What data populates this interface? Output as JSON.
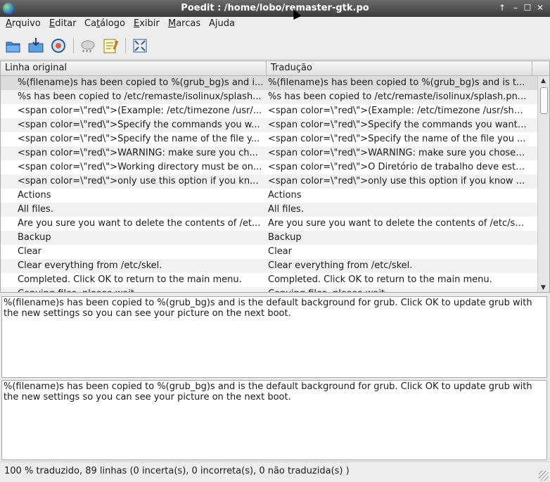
{
  "window": {
    "title": "Poedit : /home/lobo/remaster-gtk.po"
  },
  "menubar": {
    "items": [
      {
        "label": "Arquivo",
        "key": "A"
      },
      {
        "label": "Editar",
        "key": "E"
      },
      {
        "label": "Catálogo",
        "key": "C"
      },
      {
        "label": "Exibir",
        "key": "E"
      },
      {
        "label": "Marcas",
        "key": "M"
      },
      {
        "label": "Ajuda",
        "key": ""
      }
    ]
  },
  "toolbar": {
    "icons": [
      "open-icon",
      "save-icon",
      "update-catalog-icon",
      "fuzzy-icon",
      "comment-icon",
      "fullscreen-icon"
    ]
  },
  "table": {
    "headers": {
      "original": "Linha original",
      "translation": "Tradução"
    },
    "rows": [
      {
        "original": "%(filename)s has been copied to %(grub_bg)s and i...",
        "translation": "%(filename)s has been copied to %(grub_bg)s and is t..."
      },
      {
        "original": "%s has been copied to /etc/remaste/isolinux/splash...",
        "translation": "%s has been copied to /etc/remaste/isolinux/splash.pn..."
      },
      {
        "original": "<span color=\\\"red\\\">(Example: /etc/timezone /usr/...",
        "translation": "<span color=\\\"red\\\">(Example: /etc/timezone /usr/sha..."
      },
      {
        "original": "<span color=\\\"red\\\">Specify the commands you w...",
        "translation": "<span color=\\\"red\\\">Specify the commands you want ..."
      },
      {
        "original": "<span color=\\\"red\\\">Specify the name of the file y...",
        "translation": "<span color=\\\"red\\\">Specify the name of the file you ..."
      },
      {
        "original": "<span color=\\\"red\\\">WARNING: make sure you ch...",
        "translation": "<span color=\\\"red\\\">WARNING: make sure you chose ..."
      },
      {
        "original": "<span color=\\\"red\\\">Working directory must be on...",
        "translation": "<span color=\\\"red\\\">O Diretório de trabalho deve esta..."
      },
      {
        "original": "<span color=\\\"red\\\">only use this option if you kn...",
        "translation": "<span color=\\\"red\\\">only use this option if you know ..."
      },
      {
        "original": "Actions",
        "translation": "Actions"
      },
      {
        "original": "All files.",
        "translation": "All files."
      },
      {
        "original": "Are you sure you want to delete the contents of /et...",
        "translation": "Are you sure you want to delete the contents of /etc/sk..."
      },
      {
        "original": "Backup",
        "translation": "Backup"
      },
      {
        "original": "Clear",
        "translation": "Clear"
      },
      {
        "original": "Clear everything from /etc/skel.",
        "translation": "Clear everything from /etc/skel."
      },
      {
        "original": "Completed. Click OK to return to the main menu.",
        "translation": "Completed. Click OK to return to the main menu."
      },
      {
        "original": "Copying files, please wait...",
        "translation": "Copying files, please wait..."
      }
    ]
  },
  "source_pane": {
    "text": "%(filename)s has been copied to %(grub_bg)s and is the default background for grub. Click OK to update grub with the new settings so you can see your picture on the next boot."
  },
  "translation_pane": {
    "text": "%(filename)s has been copied to %(grub_bg)s and is the default background for grub. Click OK to update grub with the new settings so you can see your picture on the next boot."
  },
  "status": {
    "text": "100 % traduzido, 89 linhas (0 incerta(s), 0 incorreta(s), 0 não traduzida(s) )"
  }
}
